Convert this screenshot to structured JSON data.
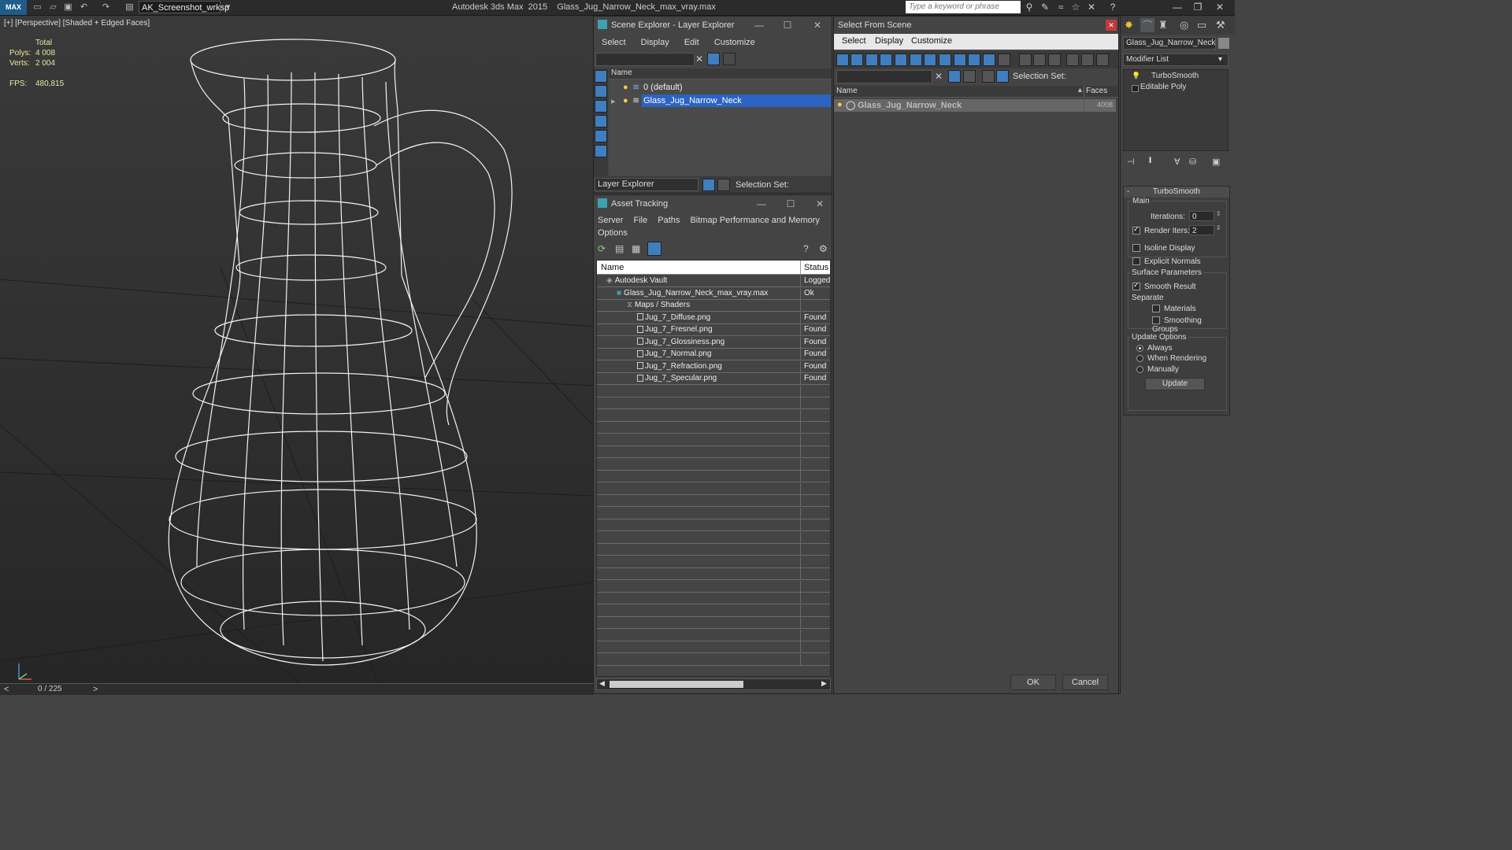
{
  "app": {
    "logo": "MAX",
    "title": "Autodesk 3ds Max  2015    Glass_Jug_Narrow_Neck_max_vray.max",
    "workspace": "AK_Screenshot_wrksp",
    "search_placeholder": "Type a keyword or phrase"
  },
  "viewport": {
    "label": "[+] [Perspective] [Shaded + Edged Faces]",
    "stats": {
      "total_label": "Total",
      "polys_label": "Polys:",
      "polys_value": "4 008",
      "verts_label": "Verts:",
      "verts_value": "2 004",
      "fps_label": "FPS:",
      "fps_value": "480,815"
    },
    "timeline": {
      "frame": "0 / 225",
      "prev": "<",
      "next": ">"
    }
  },
  "layer_explorer": {
    "title": "Scene Explorer - Layer Explorer",
    "menu": [
      "Select",
      "Display",
      "Edit",
      "Customize"
    ],
    "column_name": "Name",
    "layers": [
      "0 (default)",
      "Glass_Jug_Narrow_Neck"
    ],
    "footer_dropdown": "Layer Explorer",
    "selection_set_label": "Selection Set:"
  },
  "asset_tracking": {
    "title": "Asset Tracking",
    "menu": [
      "Server",
      "File",
      "Paths",
      "Bitmap Performance and Memory"
    ],
    "menu2": "Options",
    "col_name": "Name",
    "col_status": "Status",
    "rows": [
      {
        "name": "Autodesk Vault",
        "status": "Logged",
        "indent": 0
      },
      {
        "name": "Glass_Jug_Narrow_Neck_max_vray.max",
        "status": "Ok",
        "indent": 1
      },
      {
        "name": "Maps / Shaders",
        "status": "",
        "indent": 2
      },
      {
        "name": "Jug_7_Diffuse.png",
        "status": "Found",
        "indent": 3
      },
      {
        "name": "Jug_7_Fresnel.png",
        "status": "Found",
        "indent": 3
      },
      {
        "name": "Jug_7_Glossiness.png",
        "status": "Found",
        "indent": 3
      },
      {
        "name": "Jug_7_Normal.png",
        "status": "Found",
        "indent": 3
      },
      {
        "name": "Jug_7_Refraction.png",
        "status": "Found",
        "indent": 3
      },
      {
        "name": "Jug_7_Specular.png",
        "status": "Found",
        "indent": 3
      }
    ]
  },
  "select_from_scene": {
    "title": "Select From Scene",
    "menu": [
      "Select",
      "Display",
      "Customize"
    ],
    "selection_set_label": "Selection Set:",
    "col_name": "Name",
    "col_faces": "Faces",
    "objects": [
      {
        "name": "Glass_Jug_Narrow_Neck",
        "faces": "4008"
      }
    ],
    "ok": "OK",
    "cancel": "Cancel"
  },
  "command_panel": {
    "object_name": "Glass_Jug_Narrow_Neck",
    "modifier_list": "Modifier List",
    "stack": [
      "TurboSmooth",
      "Editable Poly"
    ],
    "turbosmooth": {
      "title": "TurboSmooth",
      "main_label": "Main",
      "iterations_label": "Iterations:",
      "iterations_value": "0",
      "render_iters_label": "Render Iters:",
      "render_iters_value": "2",
      "isoline": "Isoline Display",
      "explicit_normals": "Explicit Normals",
      "surface_params": "Surface Parameters",
      "smooth_result": "Smooth Result",
      "separate": "Separate",
      "materials": "Materials",
      "smoothing_groups": "Smoothing Groups",
      "update_options": "Update Options",
      "always": "Always",
      "when_rendering": "When Rendering",
      "manually": "Manually",
      "update_button": "Update"
    }
  }
}
